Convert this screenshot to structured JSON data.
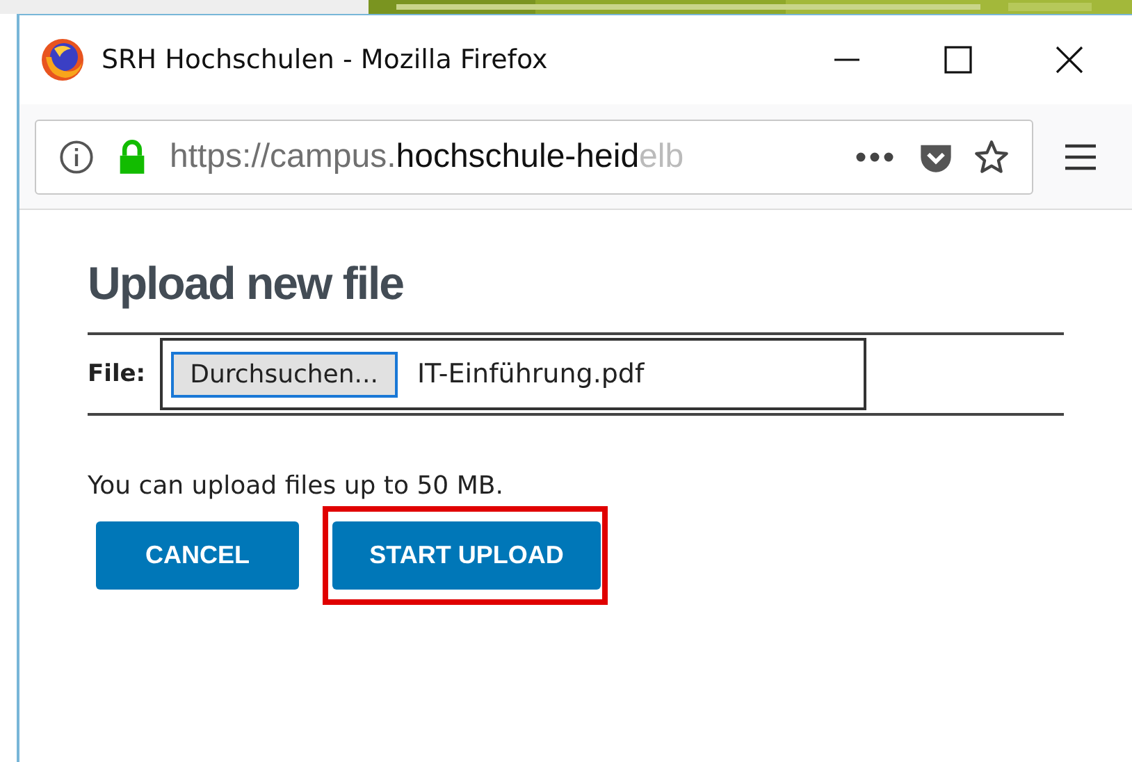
{
  "window": {
    "title": "SRH Hochschulen - Mozilla Firefox"
  },
  "address_bar": {
    "url_dim": "https://campus.",
    "url_host": "hochschule-heid",
    "url_fade": "elb"
  },
  "page": {
    "heading": "Upload new file",
    "file_label": "File:",
    "browse_button": "Durchsuchen...",
    "file_name": "IT-Einführung.pdf",
    "note": "You can upload files up to 50 MB.",
    "buttons": [
      {
        "label": "CANCEL",
        "highlighted": false
      },
      {
        "label": "START UPLOAD",
        "highlighted": true
      }
    ]
  }
}
